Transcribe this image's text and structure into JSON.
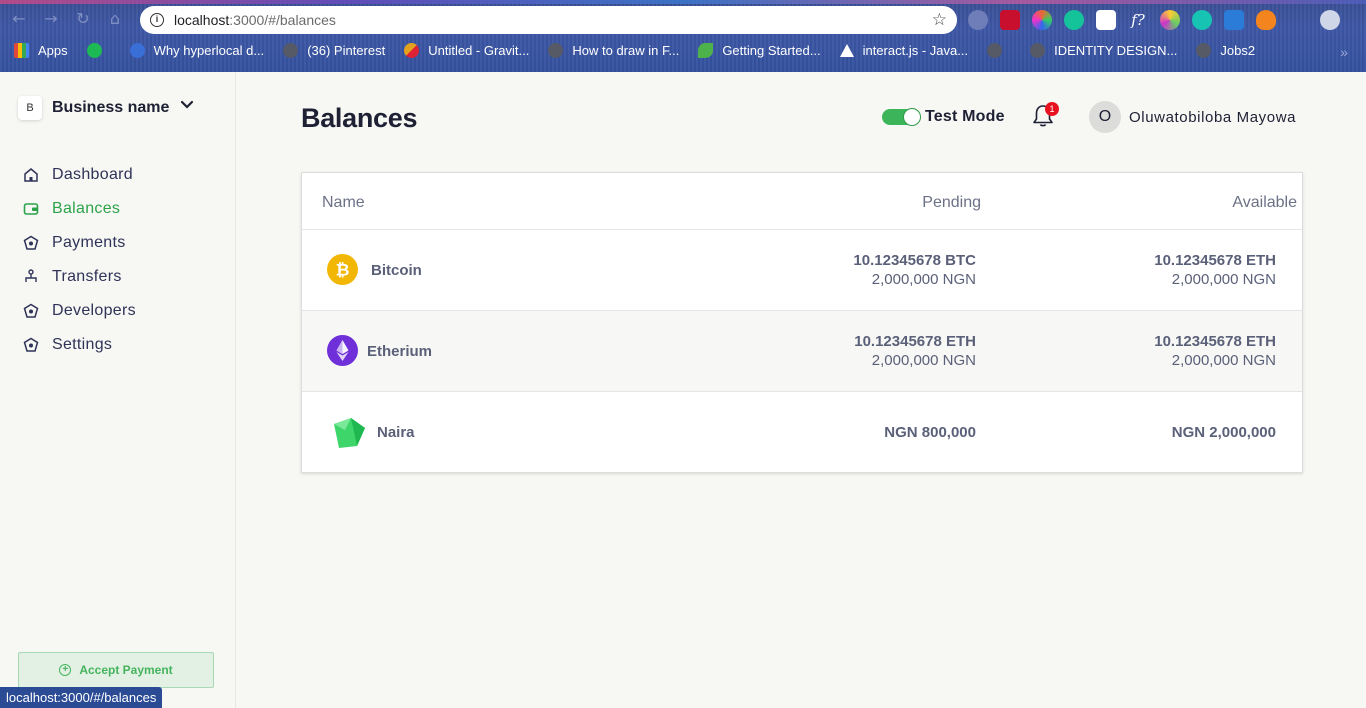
{
  "browser": {
    "url_host": "localhost",
    "url_path": ":3000/#/balances",
    "bookmarks": [
      {
        "label": "Apps",
        "color": "#e0493a"
      },
      {
        "label": "",
        "color": "#1db954"
      },
      {
        "label": "Why hyperlocal d...",
        "color": "#3a6fd8"
      },
      {
        "label": "(36) Pinterest",
        "color": "#555a66"
      },
      {
        "label": "Untitled - Gravit...",
        "color": "#e2a21e"
      },
      {
        "label": "How to draw in F...",
        "color": "#555a66"
      },
      {
        "label": "Getting Started...",
        "color": "#4db24a"
      },
      {
        "label": "interact.js - Java...",
        "color": "#ffffff"
      },
      {
        "label": "",
        "color": "#555a66"
      },
      {
        "label": "IDENTITY DESIGN...",
        "color": "#555a66"
      },
      {
        "label": "Jobs2",
        "color": "#555a66"
      }
    ],
    "status_url": "localhost:3000/#/balances"
  },
  "sidebar": {
    "business_initial": "B",
    "business_name": "Business name",
    "items": [
      {
        "label": "Dashboard",
        "icon": "home-icon"
      },
      {
        "label": "Balances",
        "icon": "wallet-icon",
        "active": true
      },
      {
        "label": "Payments",
        "icon": "payments-icon"
      },
      {
        "label": "Transfers",
        "icon": "transfers-icon"
      },
      {
        "label": "Developers",
        "icon": "developers-icon"
      },
      {
        "label": "Settings",
        "icon": "settings-icon"
      }
    ],
    "accept_payment_label": "Accept Payment"
  },
  "header": {
    "title": "Balances",
    "test_mode_label": "Test Mode",
    "test_mode_on": true,
    "notification_count": "1",
    "user_initial": "O",
    "user_name": "Oluwatobiloba Mayowa"
  },
  "table": {
    "columns": {
      "name": "Name",
      "pending": "Pending",
      "available": "Available"
    },
    "rows": [
      {
        "name": "Bitcoin",
        "icon": "bitcoin-icon",
        "pending_primary": "10.12345678 BTC",
        "pending_secondary": "2,000,000 NGN",
        "available_primary": "10.12345678 ETH",
        "available_secondary": "2,000,000 NGN"
      },
      {
        "name": "Etherium",
        "icon": "ethereum-icon",
        "pending_primary": "10.12345678 ETH",
        "pending_secondary": "2,000,000 NGN",
        "available_primary": "10.12345678 ETH",
        "available_secondary": "2,000,000 NGN"
      },
      {
        "name": "Naira",
        "icon": "naira-icon",
        "pending_primary": "NGN 800,000",
        "pending_secondary": "",
        "available_primary": "NGN 2,000,000",
        "available_secondary": ""
      }
    ]
  },
  "colors": {
    "accent_green": "#2ca34a",
    "bitcoin": "#f2b705",
    "ethereum": "#6f2fd9",
    "naira": "#3ed66b",
    "badge_red": "#e8121f"
  }
}
